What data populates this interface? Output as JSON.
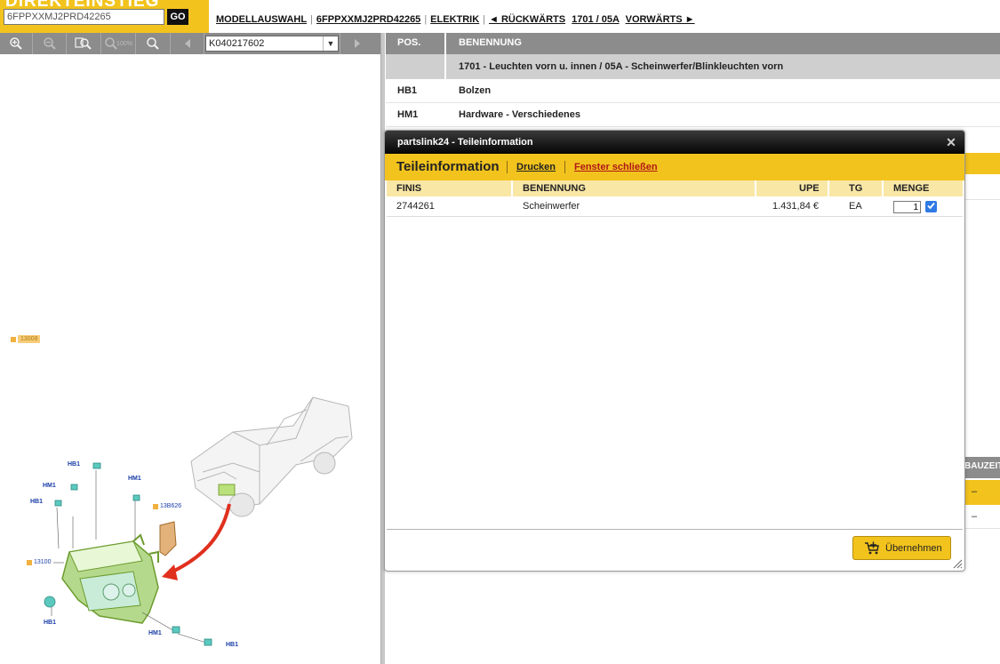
{
  "header": {
    "logo_text": "DIREKTEINSTIEG",
    "vin_input_value": "6FPPXXMJ2PRD42265",
    "go_label": "GO",
    "nav": {
      "model": "MODELLAUSWAHL",
      "vin": "6FPPXXMJ2PRD42265",
      "category": "ELEKTRIK",
      "back": "◄ RÜCKWÄRTS",
      "page": "1701 / 05A",
      "forward": "VORWÄRTS ►"
    },
    "separator": "|"
  },
  "toolbar": {
    "zoom_100_label": "100%",
    "drawing_value": "K040217602"
  },
  "drawing": {
    "callouts": {
      "c13008": "13008",
      "hb1_top": "HB1",
      "hm1_left": "HM1",
      "hb1_left": "HB1",
      "hm1_mid": "HM1",
      "c13b626": "13B626",
      "c13100": "13100",
      "hb1_bottom_left": "HB1",
      "hm1_bottom": "HM1",
      "hb1_bottom_right": "HB1"
    }
  },
  "parts_table": {
    "headers": {
      "pos": "POS.",
      "name": "BENENNUNG"
    },
    "group_title": "1701 - Leuchten vorn u. innen / 05A - Scheinwerfer/Blinkleuchten vorn",
    "rows": [
      {
        "pos": "HB1",
        "name": "Bolzen"
      },
      {
        "pos": "HM1",
        "name": "Hardware - Verschiedenes"
      }
    ],
    "bauzeit_header": "BAUZEIT",
    "bauzeit_values": [
      "–",
      "–"
    ]
  },
  "modal": {
    "title": "partslink24 - Teileinformation",
    "close_icon": "close-icon",
    "heading": "Teileinformation",
    "print_label": "Drucken",
    "close_window_label": "Fenster schließen",
    "columns": {
      "finis": "FINIS",
      "name": "BENENNUNG",
      "upe": "UPE",
      "tg": "TG",
      "qty": "MENGE"
    },
    "part": {
      "finis": "2744261",
      "name": "Scheinwerfer",
      "upe": "1.431,84 €",
      "tg": "EA",
      "qty": "1",
      "selected": true
    },
    "apply_label": "Übernehmen"
  },
  "colors": {
    "brand_yellow": "#f2c31d",
    "toolbar_gray": "#8c8c8c",
    "callout_blue": "#1a3ea8",
    "checkbox_blue": "#2f7ae5"
  }
}
